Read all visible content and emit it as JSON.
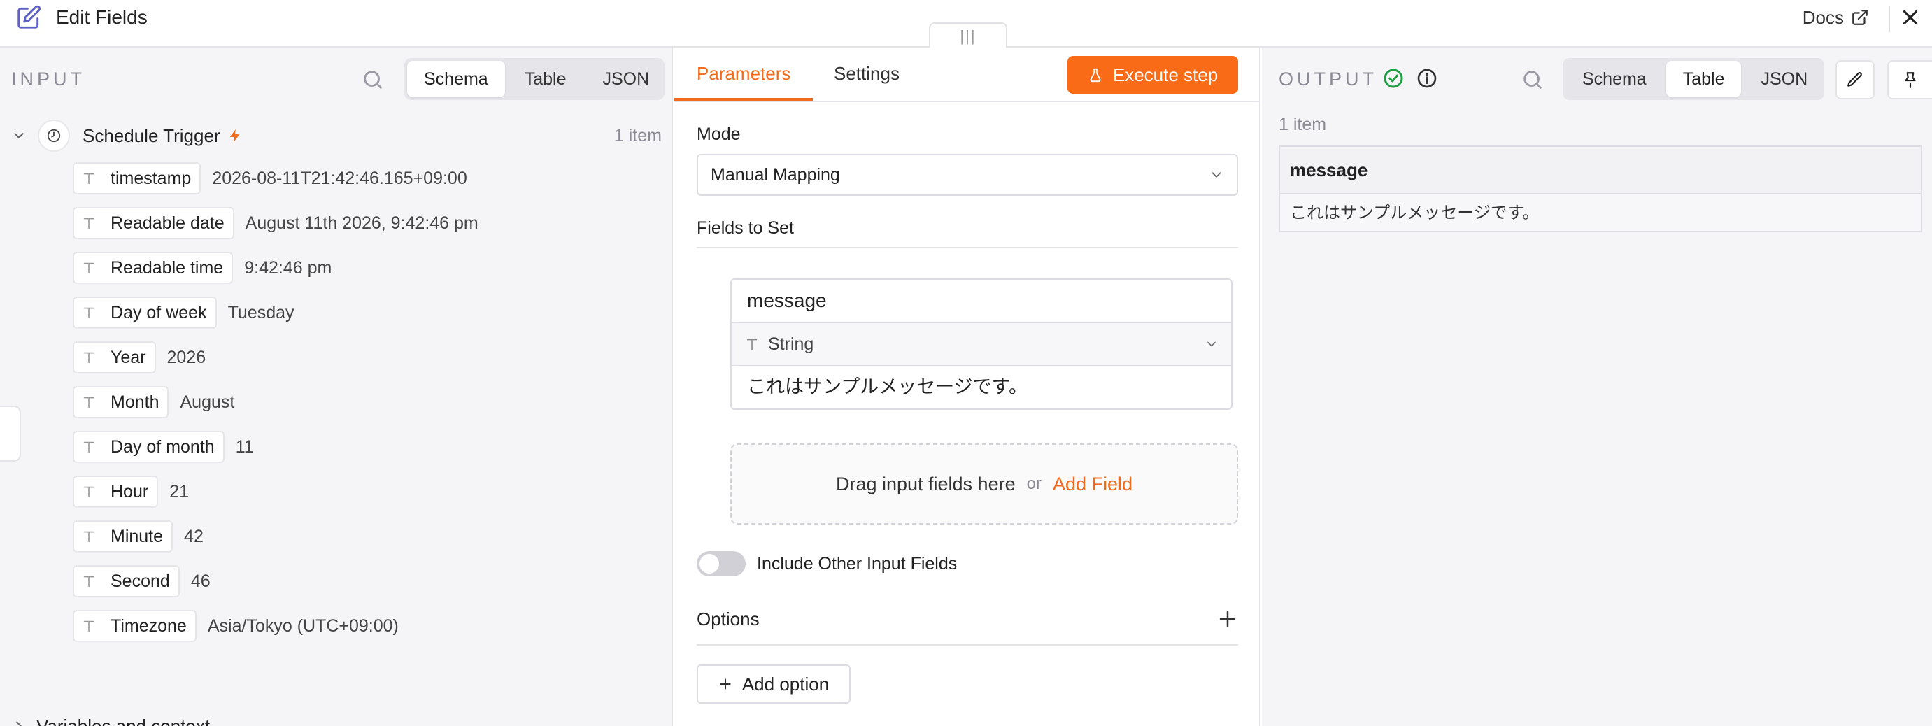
{
  "header": {
    "title": "Edit Fields",
    "docs_label": "Docs",
    "drag_handle": "|||"
  },
  "input": {
    "label": "INPUT",
    "view_tabs": [
      "Schema",
      "Table",
      "JSON"
    ],
    "active_view": "Schema",
    "trigger": {
      "name": "Schedule Trigger",
      "count": "1 item"
    },
    "fields": [
      {
        "name": "timestamp",
        "value": "2026-08-11T21:42:46.165+09:00"
      },
      {
        "name": "Readable date",
        "value": "August 11th 2026, 9:42:46 pm"
      },
      {
        "name": "Readable time",
        "value": "9:42:46 pm"
      },
      {
        "name": "Day of week",
        "value": "Tuesday"
      },
      {
        "name": "Year",
        "value": "2026"
      },
      {
        "name": "Month",
        "value": "August"
      },
      {
        "name": "Day of month",
        "value": "11"
      },
      {
        "name": "Hour",
        "value": "21"
      },
      {
        "name": "Minute",
        "value": "42"
      },
      {
        "name": "Second",
        "value": "46"
      },
      {
        "name": "Timezone",
        "value": "Asia/Tokyo (UTC+09:00)"
      }
    ],
    "variables_label": "Variables and context"
  },
  "params": {
    "tabs": [
      "Parameters",
      "Settings"
    ],
    "active_tab": "Parameters",
    "execute_label": "Execute step",
    "mode_label": "Mode",
    "mode_value": "Manual Mapping",
    "fields_to_set_label": "Fields to Set",
    "field": {
      "name": "message",
      "type": "String",
      "value": "これはサンプルメッセージです。"
    },
    "drop_zone": {
      "text": "Drag input fields here",
      "or": "or",
      "add_field": "Add Field"
    },
    "include_other_label": "Include Other Input Fields",
    "include_other_enabled": false,
    "options_label": "Options",
    "add_option_label": "Add option"
  },
  "output": {
    "label": "OUTPUT",
    "view_tabs": [
      "Schema",
      "Table",
      "JSON"
    ],
    "active_view": "Table",
    "item_count": "1 item",
    "table": {
      "columns": [
        "message"
      ],
      "rows": [
        [
          "これはサンプルメッセージです。"
        ]
      ]
    }
  },
  "colors": {
    "accent": "#f26a1b",
    "success": "#1a9e3f",
    "panel_bg": "#f5f5f7",
    "brand_icon": "#5b5fc7"
  },
  "icons": {
    "title": "edit-square-icon",
    "docs": "external-link-icon",
    "close": "close-icon",
    "search": "search-icon",
    "trigger": "clock-icon",
    "trigger_badge": "lightning-icon",
    "field_type": "text-type-icon",
    "execute": "flask-icon",
    "output_status": "check-circle-icon",
    "output_info": "info-icon",
    "edit": "pencil-icon",
    "pin": "pin-icon"
  }
}
